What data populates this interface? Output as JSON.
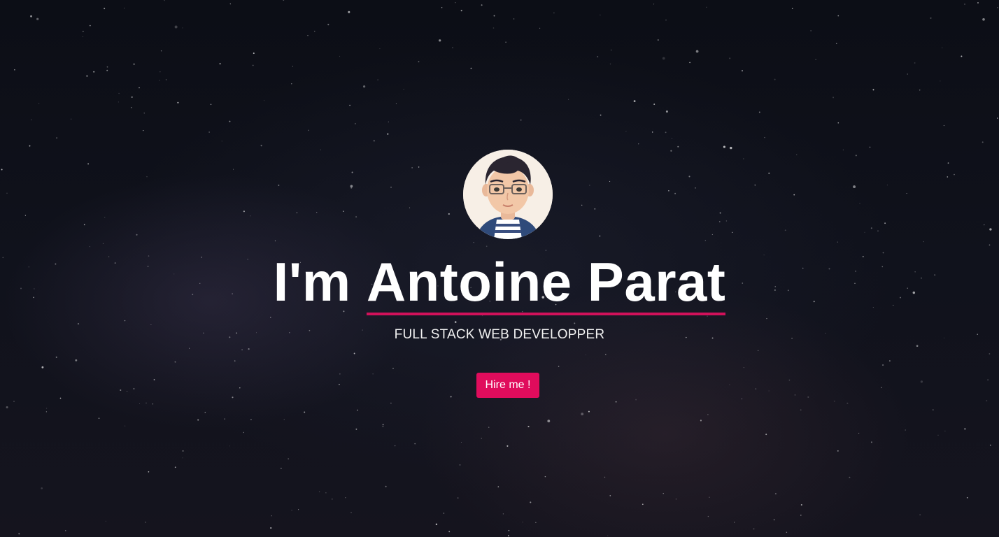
{
  "hero": {
    "greeting": "I'm",
    "name": "Antoine Parat",
    "subtitle": "FULL STACK WEB DEVELOPPER",
    "cta_label": "Hire me !"
  },
  "colors": {
    "accent": "#e00c5c",
    "underline": "#d1115a",
    "background": "#0d0f17",
    "text": "#ffffff"
  },
  "icons": {
    "avatar": "cartoon-portrait-with-glasses"
  }
}
